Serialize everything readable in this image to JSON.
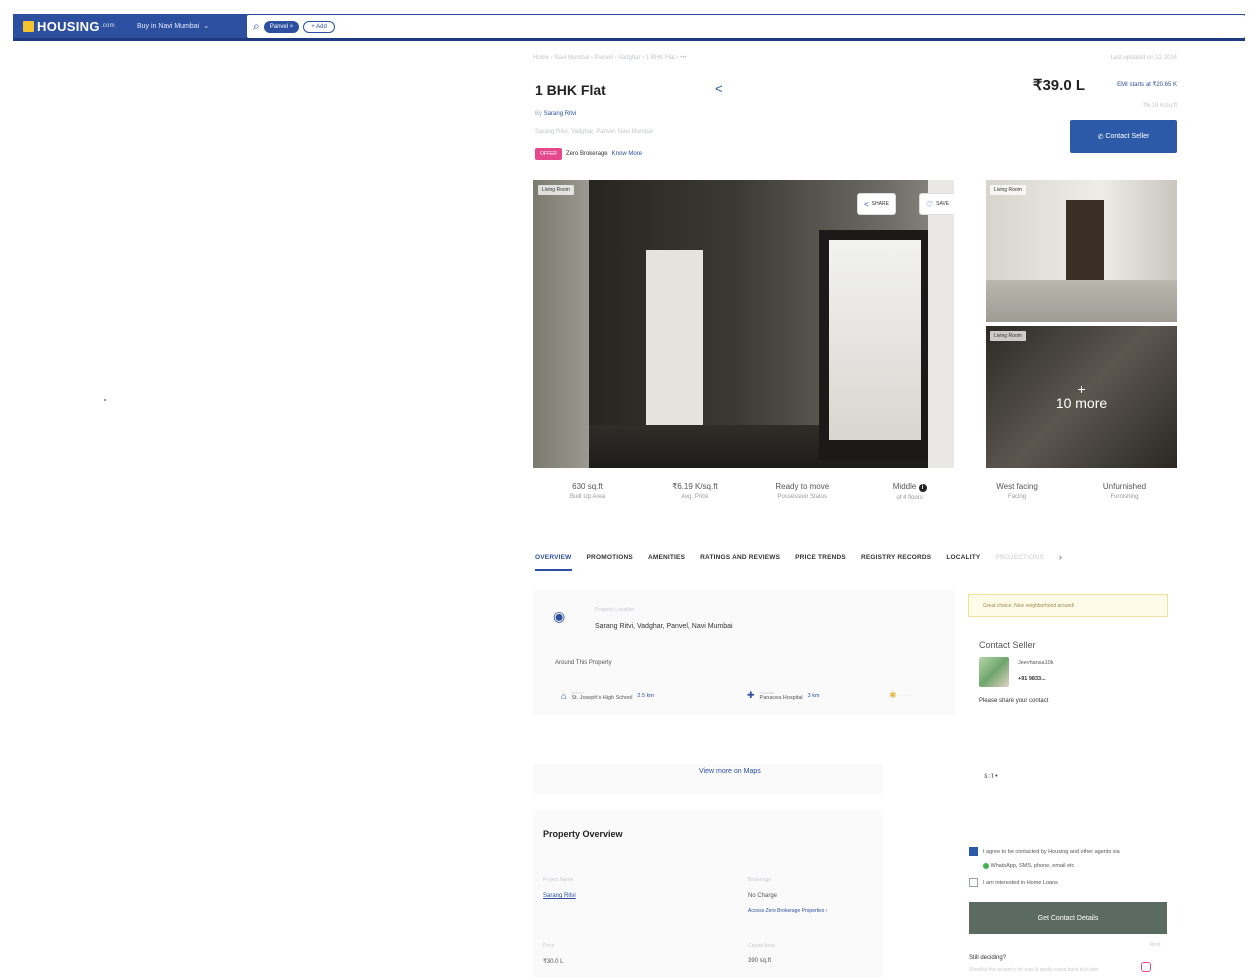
{
  "header": {
    "logo_text": "HOUSING",
    "logo_suffix": ".com",
    "city_label": "Buy in Navi Mumbai",
    "search_chip": "Panvel",
    "add_chip": "+ Add"
  },
  "listing": {
    "breadcrumb": "Home › Navi Mumbai › Panvel › Vadghar › 1 BHK Flat ›  •••",
    "updated": "Last updated on 12 2024",
    "title": "1 BHK Flat",
    "price": "₹39.0 L",
    "emi": "EMI starts at ₹20.65 K",
    "price_sub": "₹6.19 K/sq ft",
    "by_prefix": "By",
    "by_name": "Sarang Ritvi",
    "address_small": "Sarang Ritvi, Vadghar, Panvel, Navi Mumbai",
    "offer_tag": "OFFER",
    "offer_text": "Zero Brokerage",
    "offer_link": "Know More",
    "contact_button": "Contact Seller"
  },
  "gallery": {
    "main_tag": "Living Room",
    "share_label": "SHARE",
    "save_label": "SAVE",
    "right_top_tag": "Living Room",
    "right_bottom_tag": "Living Room",
    "more_plus": "+",
    "more_label": "10 more"
  },
  "stats": [
    {
      "value": "630 sq.ft",
      "label": "Built Up Area"
    },
    {
      "value": "₹6.19 K/sq.ft",
      "label": "Avg. Price"
    },
    {
      "value": "Ready to move",
      "label": "Possession Status"
    },
    {
      "value": "Middle",
      "label": "of 4 floors"
    },
    {
      "value": "West facing",
      "label": "Facing"
    },
    {
      "value": "Unfurnished",
      "label": "Furnishing"
    }
  ],
  "tabs": [
    "OVERVIEW",
    "PROMOTIONS",
    "AMENITIES",
    "RATINGS AND REVIEWS",
    "PRICE TRENDS",
    "REGISTRY RECORDS",
    "LOCALITY",
    "PROJECTIONS"
  ],
  "location": {
    "small_label": "Property Location",
    "address": "Sarang Ritvi, Vadghar, Panvel, Navi Mumbai",
    "around_label": "Around This Property",
    "poi": [
      {
        "type": "School",
        "name": "St. Joseph's High School",
        "dist": "2.5 km"
      },
      {
        "type": "Hospital",
        "name": "Panacea Hospital",
        "dist": "3 km"
      },
      {
        "type": "",
        "name": "",
        "dist": ""
      }
    ],
    "map_link": "View more on Maps"
  },
  "contact": {
    "notice": "Great choice. Nice neighborhood around!",
    "title": "Contact Seller",
    "name": "Jeevhansa10k",
    "phone": "+91 9833...",
    "share_prompt": "Please share your contact",
    "stray": "ऽा •",
    "agree_text": "I agree to be contacted by Housing and other agents via",
    "agree_text2": "WhatsApp, SMS, phone, email etc",
    "loan_text": "I am interested in Home Loans",
    "get_details": "Get Contact Details",
    "still_text": "Still deciding?",
    "still_sub": "Shortlist this property for now & easily come back to it later",
    "side_faint": "Rent"
  },
  "overview": {
    "title": "Property Overview",
    "rows": [
      {
        "label": "Project Name",
        "value": "Sarang Ritvi"
      },
      {
        "label": "Brokerage",
        "value": "No Charge",
        "link": "Access Zero Brokerage Properties ›"
      },
      {
        "label": "Price",
        "value": "₹30.0 L"
      },
      {
        "label": "Carpet Area",
        "value": "390 sq.ft"
      }
    ]
  }
}
